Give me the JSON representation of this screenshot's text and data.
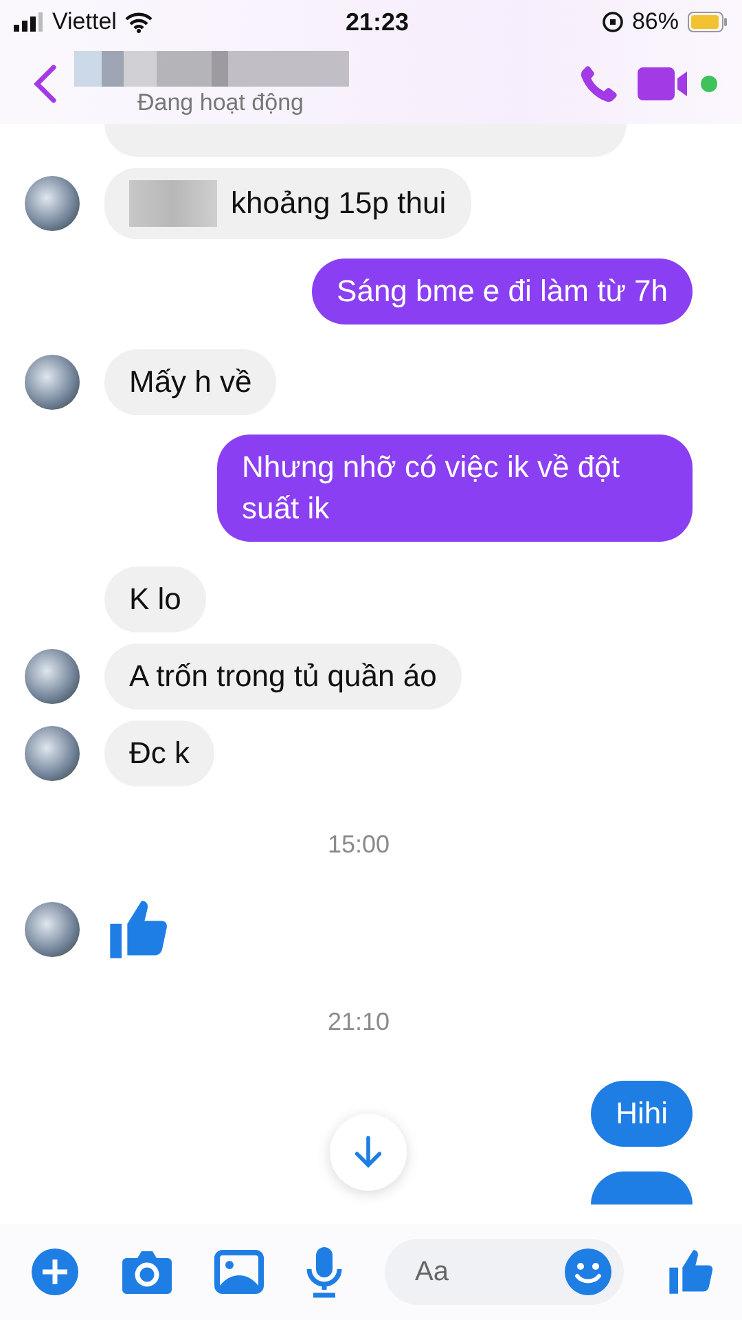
{
  "status_bar": {
    "carrier": "Viettel",
    "time": "21:23",
    "battery": "86%"
  },
  "header": {
    "status": "Đang hoạt động",
    "name_blurred": true,
    "online": true
  },
  "messages": [
    {
      "kind": "stub_received"
    },
    {
      "kind": "received",
      "avatar": true,
      "blurred_prefix": true,
      "text": "khoảng 15p thui"
    },
    {
      "kind": "sent",
      "text": "Sáng bme e đi làm từ 7h",
      "color": "#8a3ff2"
    },
    {
      "kind": "received",
      "avatar": true,
      "blurred_prefix": false,
      "text": "Mấy h về"
    },
    {
      "kind": "sent",
      "text": "Nhưng nhỡ có việc ik về đột suất ik",
      "color": "#8a3ff2"
    },
    {
      "kind": "received",
      "avatar": false,
      "blurred_prefix": false,
      "text": "K lo"
    },
    {
      "kind": "received",
      "avatar": true,
      "blurred_prefix": false,
      "text": "A trốn trong tủ quần áo"
    },
    {
      "kind": "received",
      "avatar": true,
      "blurred_prefix": false,
      "text": "Đc k"
    },
    {
      "kind": "time",
      "text": "15:00"
    },
    {
      "kind": "like",
      "avatar": true
    },
    {
      "kind": "time",
      "text": "21:10"
    },
    {
      "kind": "sent",
      "text": "Hihi",
      "color": "#1e7ee4"
    },
    {
      "kind": "stub_sent",
      "color": "#1e7ee4"
    }
  ],
  "composer": {
    "placeholder": "Aa"
  }
}
